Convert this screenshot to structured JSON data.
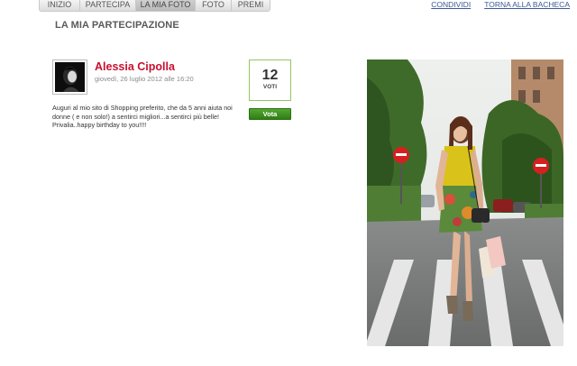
{
  "nav": {
    "tabs": [
      {
        "label": "INIZIO",
        "active": false
      },
      {
        "label": "PARTECIPA",
        "active": false
      },
      {
        "label": "LA MIA FOTO",
        "active": true
      },
      {
        "label": "FOTO",
        "active": false
      },
      {
        "label": "PREMI",
        "active": false
      }
    ],
    "links": {
      "share": "CONDIVIDI",
      "back": "TORNA ALLA BACHECA"
    }
  },
  "section_title": "LA MIA PARTECIPAZIONE",
  "entry": {
    "author": "Alessia Cipolla",
    "date": "giovedì, 26 luglio 2012 alle 16:20",
    "text": "Auguri al mio sito di Shopping preferito, che da 5 anni aiuta noi donne ( e non solo!) a sentirci migliori...a sentirci più belle! Privalia..happy birthday to you!!!!",
    "votes": "12",
    "votes_label": "VOTI",
    "vote_button": "Vota"
  },
  "colors": {
    "author_red": "#c8102e",
    "vote_green": "#3a8f1e",
    "link_blue": "#3c5a94"
  }
}
